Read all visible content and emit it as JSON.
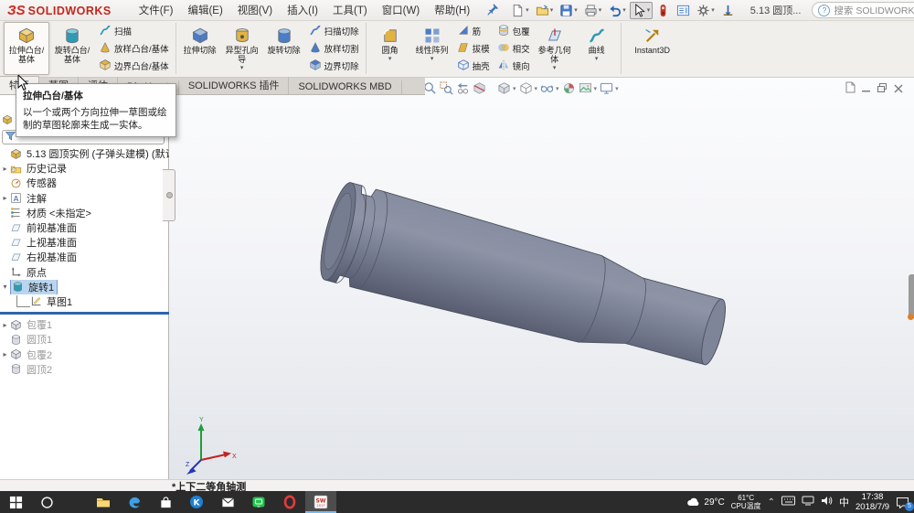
{
  "window": {
    "logo_glyph": "ЗS",
    "brand": "SOLIDWORKS",
    "menus": [
      "文件(F)",
      "编辑(E)",
      "视图(V)",
      "插入(I)",
      "工具(T)",
      "窗口(W)",
      "帮助(H)"
    ],
    "doc_title": "5.13 圆顶...",
    "search_placeholder": "搜索 SOLIDWORKS 帮助",
    "help_glyph": "?",
    "quickbar": [
      {
        "name": "new-doc",
        "dd": true
      },
      {
        "name": "open",
        "dd": true
      },
      {
        "name": "save",
        "dd": true
      },
      {
        "name": "print",
        "dd": true
      },
      {
        "name": "undo",
        "dd": true
      },
      {
        "name": "select-cursor",
        "dd": true,
        "active": true
      },
      {
        "name": "selection-filter",
        "dd": false
      },
      {
        "name": "display-pane",
        "dd": false
      },
      {
        "name": "options-gear",
        "dd": true
      },
      {
        "name": "measure-tool",
        "dd": false
      }
    ]
  },
  "ribbon": {
    "cells": [
      {
        "t": "big",
        "label": "拉伸凸台/基体",
        "icon": "extrude",
        "active": true
      },
      {
        "t": "big",
        "label": "旋转凸台/基体",
        "icon": "revolve"
      },
      {
        "t": "stack",
        "items": [
          {
            "label": "扫描",
            "icon": "sweep"
          },
          {
            "label": "放样凸台/基体",
            "icon": "loft"
          },
          {
            "label": "边界凸台/基体",
            "icon": "boundary"
          }
        ]
      },
      {
        "t": "sep"
      },
      {
        "t": "big",
        "label": "拉伸切除",
        "icon": "cut-extrude"
      },
      {
        "t": "big",
        "label": "异型孔向导",
        "icon": "hole-wizard",
        "dd": true
      },
      {
        "t": "big",
        "label": "旋转切除",
        "icon": "cut-revolve"
      },
      {
        "t": "stack",
        "items": [
          {
            "label": "扫描切除",
            "icon": "cut-sweep"
          },
          {
            "label": "放样切割",
            "icon": "cut-loft"
          },
          {
            "label": "边界切除",
            "icon": "cut-boundary"
          }
        ]
      },
      {
        "t": "sep"
      },
      {
        "t": "big",
        "label": "圆角",
        "icon": "fillet",
        "dd": true
      },
      {
        "t": "big",
        "label": "线性阵列",
        "icon": "pattern",
        "dd": true
      },
      {
        "t": "stack",
        "items": [
          {
            "label": "筋",
            "icon": "rib"
          },
          {
            "label": "拔模",
            "icon": "draft"
          },
          {
            "label": "抽壳",
            "icon": "shell"
          }
        ]
      },
      {
        "t": "stack",
        "items": [
          {
            "label": "包覆",
            "icon": "wrap"
          },
          {
            "label": "相交",
            "icon": "intersect"
          },
          {
            "label": "镜向",
            "icon": "mirror"
          }
        ]
      },
      {
        "t": "big",
        "label": "参考几何体",
        "icon": "refgeom",
        "dd": true
      },
      {
        "t": "big",
        "label": "曲线",
        "icon": "curves",
        "dd": true
      },
      {
        "t": "sep"
      },
      {
        "t": "big",
        "label": "Instant3D",
        "icon": "instant3d"
      }
    ],
    "tabs": [
      {
        "label": "特征",
        "active": true
      },
      {
        "label": "草图"
      },
      {
        "label": "评估"
      },
      {
        "label": "DimXpert"
      },
      {
        "label": "SOLIDWORKS 插件"
      },
      {
        "label": "SOLIDWORKS MBD"
      }
    ]
  },
  "tooltip": {
    "title": "拉伸凸台/基体",
    "body": "以一个或两个方向拉伸一草图或绘制的草图轮廓来生成一实体。"
  },
  "tree": {
    "root_label": "5.13 圆顶实例 (子弹头建模)",
    "root_suffix": "(默认<<默",
    "items": [
      {
        "label": "历史记录",
        "icon": "history",
        "arrow": "right"
      },
      {
        "label": "传感器",
        "icon": "sensor"
      },
      {
        "label": "注解",
        "icon": "note",
        "arrow": "right"
      },
      {
        "label": "材质 <未指定>",
        "icon": "material"
      },
      {
        "label": "前视基准面",
        "icon": "plane"
      },
      {
        "label": "上视基准面",
        "icon": "plane"
      },
      {
        "label": "右视基准面",
        "icon": "plane"
      },
      {
        "label": "原点",
        "icon": "origin"
      },
      {
        "label": "旋转1",
        "icon": "revolve-f",
        "arrow": "down",
        "selected": true
      },
      {
        "label": "草图1",
        "icon": "sketch",
        "child": true
      },
      {
        "rollback": true
      },
      {
        "label": "包覆1",
        "icon": "wrap-f",
        "arrow": "right",
        "dim": true
      },
      {
        "label": "圆顶1",
        "icon": "dome-f",
        "dim": true
      },
      {
        "label": "包覆2",
        "icon": "wrap-f",
        "arrow": "right",
        "dim": true
      },
      {
        "label": "圆顶2",
        "icon": "dome-f",
        "dim": true
      }
    ]
  },
  "viewport": {
    "headsup": [
      {
        "name": "zoom-fit"
      },
      {
        "name": "zoom-area"
      },
      {
        "name": "previous-view"
      },
      {
        "name": "section-view"
      },
      {
        "gap": true
      },
      {
        "name": "view-orientation",
        "dd": true
      },
      {
        "name": "display-style",
        "dd": true
      },
      {
        "name": "hide-show-items",
        "dd": true
      },
      {
        "name": "edit-appearance"
      },
      {
        "name": "apply-scene",
        "dd": true
      },
      {
        "name": "view-settings",
        "dd": true
      }
    ],
    "status_view_label": "*上下二等角轴测",
    "triad_axes": {
      "x": "X",
      "y": "Y",
      "z": "Z"
    }
  },
  "taskbar": {
    "apps": [
      {
        "name": "start"
      },
      {
        "name": "cortana"
      },
      {
        "name": "explorer"
      },
      {
        "name": "edge"
      },
      {
        "name": "store"
      },
      {
        "name": "k-app"
      },
      {
        "name": "mail"
      },
      {
        "name": "iqiyi"
      },
      {
        "name": "opera"
      },
      {
        "name": "solidworks",
        "active": true
      }
    ],
    "weather_temp": "29°C",
    "cpu_temp": "61°C",
    "cpu_label": "CPU温度",
    "ime_indicator": "中",
    "time": "17:38",
    "date": "2018/7/9",
    "notification_badge": "5"
  },
  "colors": {
    "accent_blue": "#2f64ad",
    "selection_fill": "#b9d5ef",
    "model_gray": "#7b8194",
    "taskbar_dark": "#2b2b2b",
    "logo_red": "#d5281e"
  }
}
